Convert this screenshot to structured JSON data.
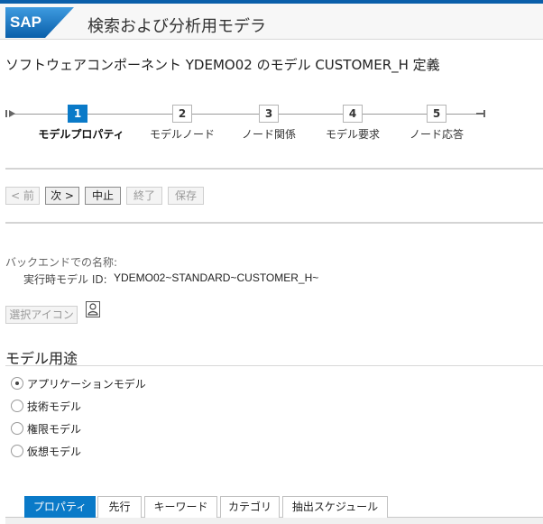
{
  "header": {
    "logo_text": "SAP",
    "app_title": "検索および分析用モデラ",
    "colors": {
      "brand_blue": "#0a5faa",
      "active_blue": "#0a7ac8"
    }
  },
  "page": {
    "title": "ソフトウェアコンポーネント YDEMO02 のモデル CUSTOMER_H 定義"
  },
  "roadmap": {
    "steps": [
      {
        "number": "1",
        "label": "モデルプロパティ",
        "active": true
      },
      {
        "number": "2",
        "label": "モデルノード",
        "active": false
      },
      {
        "number": "3",
        "label": "ノード関係",
        "active": false
      },
      {
        "number": "4",
        "label": "モデル要求",
        "active": false
      },
      {
        "number": "5",
        "label": "ノード応答",
        "active": false
      }
    ]
  },
  "toolbar": {
    "back_label": "< 前",
    "next_label": "次 >",
    "cancel_label": "中止",
    "finish_label": "終了",
    "save_label": "保存"
  },
  "details": {
    "backend_name_label": "バックエンドでの名称:",
    "runtime_model_id_label": "実行時モデル ID:",
    "runtime_model_id_value": "YDEMO02~STANDARD~CUSTOMER_H~",
    "select_icon_label": "選択アイコン",
    "icon": "person-icon"
  },
  "model_usage": {
    "title": "モデル用途",
    "options": [
      {
        "label": "アプリケーションモデル",
        "checked": true
      },
      {
        "label": "技術モデル",
        "checked": false
      },
      {
        "label": "権限モデル",
        "checked": false
      },
      {
        "label": "仮想モデル",
        "checked": false
      }
    ]
  },
  "tabs": [
    {
      "label": "プロパティ",
      "active": true
    },
    {
      "label": "先行",
      "active": false
    },
    {
      "label": "キーワード",
      "active": false
    },
    {
      "label": "カテゴリ",
      "active": false
    },
    {
      "label": "抽出スケジュール",
      "active": false
    }
  ]
}
